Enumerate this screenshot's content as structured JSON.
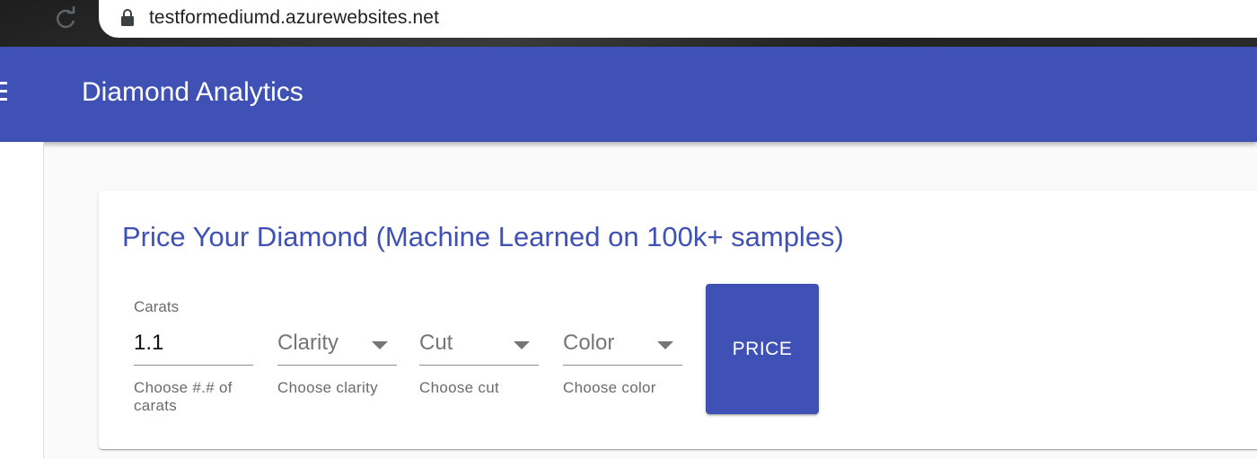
{
  "browser": {
    "url": "testformediumd.azurewebsites.net",
    "lock_icon": "lock-icon",
    "reload_icon": "reload-icon"
  },
  "toolbar": {
    "menu_icon": "hamburger-menu-icon",
    "title": "Diamond Analytics",
    "background_color": "#3f51b5"
  },
  "card": {
    "title": "Price Your Diamond (Machine Learned on 100k+ samples)",
    "fields": [
      {
        "label": "Carats",
        "value": "1.1",
        "hint": "Choose #.# of carats"
      },
      {
        "placeholder": "Clarity",
        "hint": "Choose clarity"
      },
      {
        "placeholder": "Cut",
        "hint": "Choose cut"
      },
      {
        "placeholder": "Color",
        "hint": "Choose color"
      }
    ],
    "price_button_label": "PRICE"
  }
}
